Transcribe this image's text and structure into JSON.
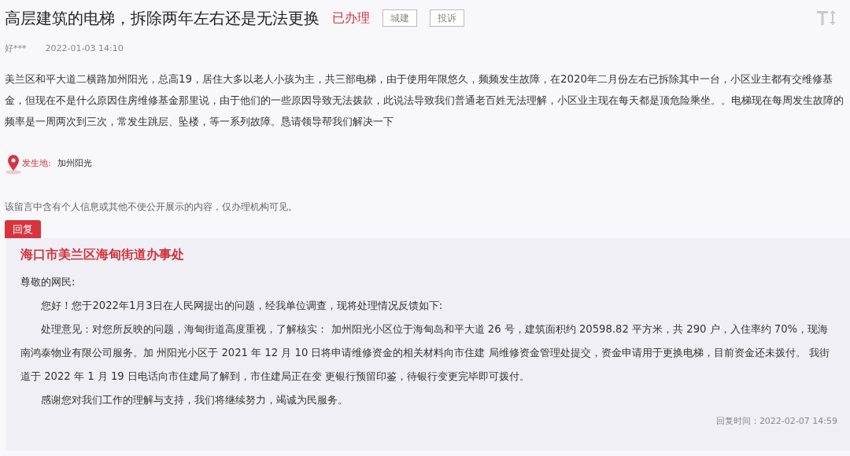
{
  "title": "高层建筑的电梯，拆除两年左右还是无法更换",
  "status": "已办理",
  "tags": [
    "城建",
    "投诉"
  ],
  "author": "好***",
  "date": "2022-01-03 14:10",
  "content": "美兰区和平大道二横路加州阳光，总高19，居住大多以老人小孩为主，共三部电梯，由于使用年限悠久，频频发生故障，在2020年二月份左右已拆除其中一台，小区业主都有交维修基金，但现在不是什么原因住房维修基金那里说，由于他们的一些原因导致无法拨款，此说法导致我们普通老百姓无法理解，小区业主现在每天都是顶危险乘坐。。电梯现在每周发生故障的频率是一周两次到三次，常发生跳层、坠楼，等一系列故障。恳请领导帮我们解决一下",
  "location": {
    "label": "发生地:",
    "value": "加州阳光"
  },
  "privacy_note": "该留言中含有个人信息或其他不便公开展示的内容，仅办理机构可见。",
  "reply": {
    "tab": "回复",
    "org": "海口市美兰区海甸街道办事处",
    "greeting": "尊敬的网民:",
    "paragraphs": [
      "您好！您于2022年1月3日在人民网提出的问题，经我单位调查，现将处理情况反馈如下:",
      "处理意见：对您所反映的问题，海甸街道高度重视，了解核实： 加州阳光小区位于海甸岛和平大道 26 号，建筑面积约 20598.82 平方米，共 290 户，入住率约 70%，现海南鸿泰物业有限公司服务。加 州阳光小区于 2021 年 12 月 10 日将申请维修资金的相关材料向市住建 局维修资金管理处提交，资金申请用于更换电梯，目前资金还未拨付。 我街道于 2022 年 1 月 19 日电话向市住建局了解到，市住建局正在变 更银行预留印鉴，待银行变更完毕即可拨付。",
      "感谢您对我们工作的理解与支持，我们将继续努力，竭诚为民服务。"
    ],
    "time": "回复时间：2022-02-07 14:59"
  }
}
